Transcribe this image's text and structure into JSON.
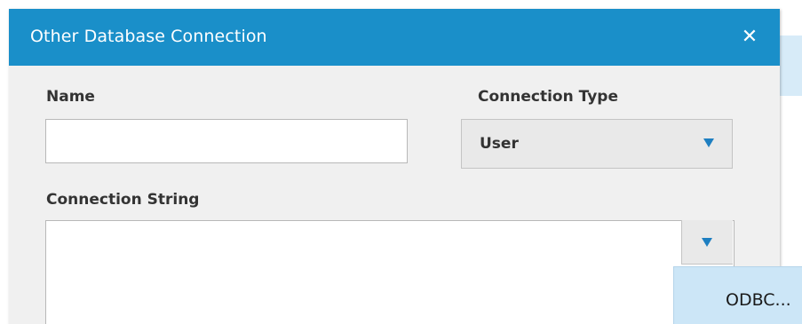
{
  "dialog": {
    "title": "Other Database Connection",
    "close_glyph": "✕"
  },
  "form": {
    "name_label": "Name",
    "name_value": "",
    "connection_type_label": "Connection Type",
    "connection_type_value": "User",
    "connection_string_label": "Connection String",
    "connection_string_value": ""
  },
  "menu": {
    "items": [
      {
        "label": "ODBC..."
      }
    ]
  },
  "colors": {
    "title_bar": "#1a8fc9",
    "accent_arrow": "#1e7fc1",
    "menu_highlight": "#cce6f7",
    "dialog_body": "#f0f0f0"
  },
  "icons": {
    "close": "close-icon",
    "dropdown": "chevron-down-icon"
  }
}
